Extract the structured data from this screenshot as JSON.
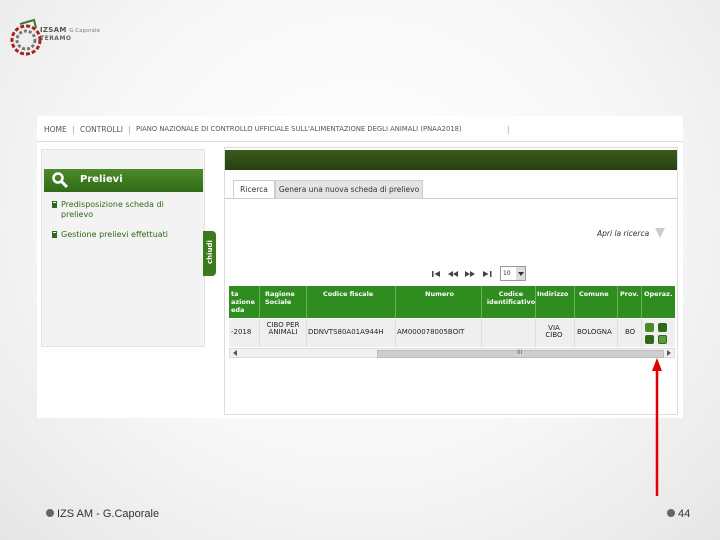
{
  "logo": {
    "name": "IZSAM",
    "suffix": "G.Caporale",
    "city": "TERAMO"
  },
  "topnav": {
    "items": [
      "HOME",
      "CONTROLLI",
      "PIANO NAZIONALE DI CONTROLLO UFFICIALE SULL'ALIMENTAZIONE DEGLI ANIMALI (PNAA2018)"
    ]
  },
  "sidebar": {
    "title": "Prelievi",
    "items": [
      {
        "label": "Predisposizione scheda di prelievo"
      },
      {
        "label": "Gestione prelievi effettuati"
      }
    ],
    "toggle": "chiudi"
  },
  "main": {
    "tabs": [
      {
        "label": "Ricerca",
        "active": true
      },
      {
        "label": "Genera una nuova scheda di prelievo",
        "active": false
      }
    ],
    "search_toggle": "Apri la ricerca",
    "pager": {
      "page_size": "10"
    },
    "table": {
      "headers": [
        "ta azione eda",
        "Ragione Sociale",
        "Codice fiscale",
        "Numero",
        "Codice identificativo",
        "Indirizzo",
        "Comune",
        "Prov.",
        "Operaz."
      ],
      "rows": [
        {
          "date": "-2018",
          "ragione": "CIBO PER ANIMALI",
          "cf": "DDNVTS80A01A944H",
          "numero": "AM000078005BOIT",
          "codice": "",
          "indirizzo": "VIA CIBO",
          "comune": "BOLOGNA",
          "prov": "BO"
        }
      ],
      "scroll_grip": "III"
    }
  },
  "footer": {
    "left": "IZS AM - G.Caporale",
    "page": "44"
  },
  "colors": {
    "brand_green": "#2f8c1e",
    "header_dark": "#2f4d16",
    "arrow_red": "#e00000"
  }
}
